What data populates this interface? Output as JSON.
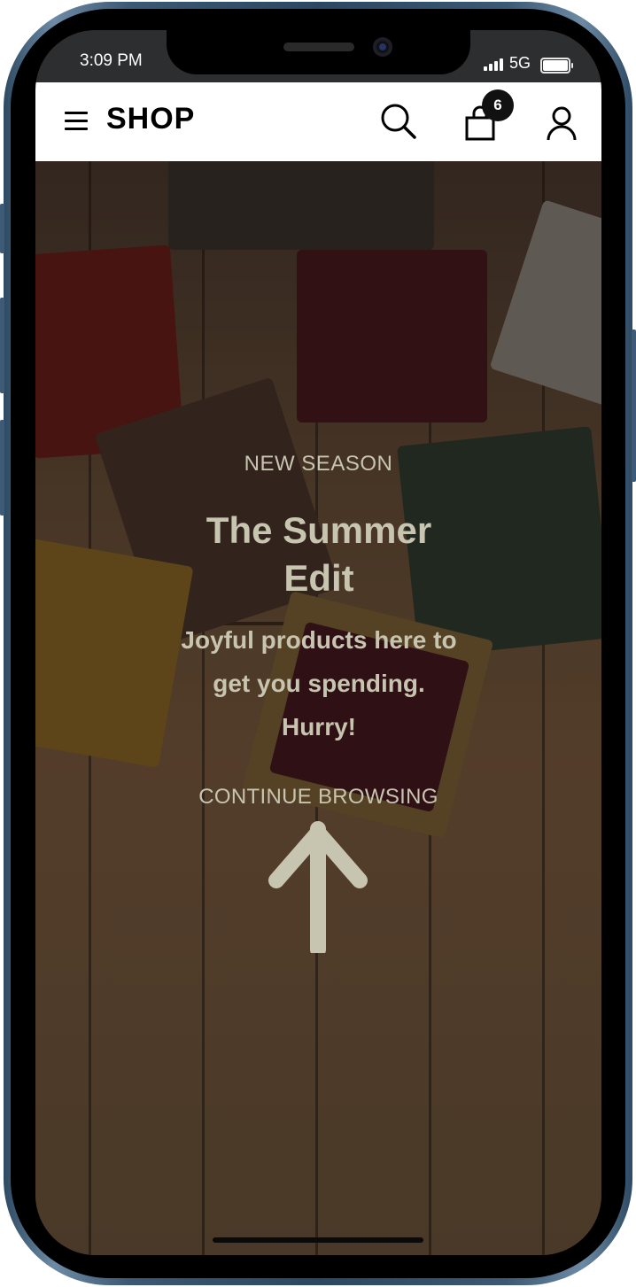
{
  "status_bar": {
    "time": "3:09 PM",
    "network": "5G"
  },
  "header": {
    "logo": "SHOP",
    "cart_count": "6",
    "icons": [
      "menu-icon",
      "search-icon",
      "cart-icon",
      "account-icon"
    ]
  },
  "hero": {
    "kicker": "NEW SEASON",
    "headline": "The Summer Edit",
    "subtext": "Joyful products here to get you spending. Hurry!",
    "cta": "CONTINUE BROWSING",
    "arrow_icon": "arrow-up-icon",
    "text_color": "#c7c4b0"
  }
}
